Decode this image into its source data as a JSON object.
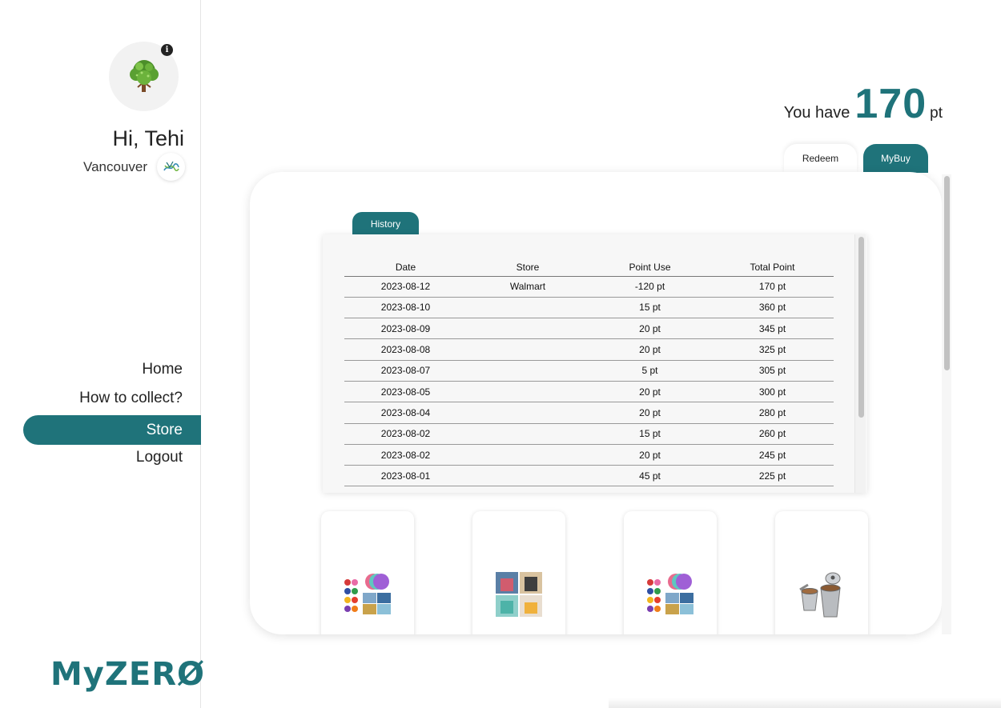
{
  "sidebar": {
    "greeting": "Hi, Tehi",
    "city": "Vancouver",
    "nav": [
      {
        "label": "Home"
      },
      {
        "label": "How to collect?"
      },
      {
        "label": "Store",
        "active": true
      },
      {
        "label": "Logout"
      }
    ],
    "logo_text": "MyZERØ"
  },
  "points": {
    "label": "You have",
    "value": "170",
    "unit": "pt"
  },
  "tabs": {
    "redeem": "Redeem",
    "mybuy": "MyBuy",
    "active": "MyBuy"
  },
  "history": {
    "tab_label": "History",
    "columns": [
      "Date",
      "Store",
      "Point Use",
      "Total Point"
    ],
    "rows": [
      [
        "2023-08-12",
        "Walmart",
        "-120 pt",
        "170 pt"
      ],
      [
        "2023-08-10",
        "",
        "15 pt",
        "360 pt"
      ],
      [
        "2023-08-09",
        "",
        "20 pt",
        "345 pt"
      ],
      [
        "2023-08-08",
        "",
        "20 pt",
        "325 pt"
      ],
      [
        "2023-08-07",
        "",
        "5 pt",
        "305 pt"
      ],
      [
        "2023-08-05",
        "",
        "20 pt",
        "300 pt"
      ],
      [
        "2023-08-04",
        "",
        "20 pt",
        "280 pt"
      ],
      [
        "2023-08-02",
        "",
        "15 pt",
        "260 pt"
      ],
      [
        "2023-08-02",
        "",
        "20 pt",
        "245 pt"
      ],
      [
        "2023-08-01",
        "",
        "45 pt",
        "225 pt"
      ]
    ]
  },
  "products": [
    {
      "icon": "silicone-lids-icon"
    },
    {
      "icon": "reusable-bags-icon"
    },
    {
      "icon": "silicone-lids-icon"
    },
    {
      "icon": "coffee-pod-icon"
    }
  ],
  "colors": {
    "accent": "#1f737a",
    "panel": "#f7f7f7"
  }
}
